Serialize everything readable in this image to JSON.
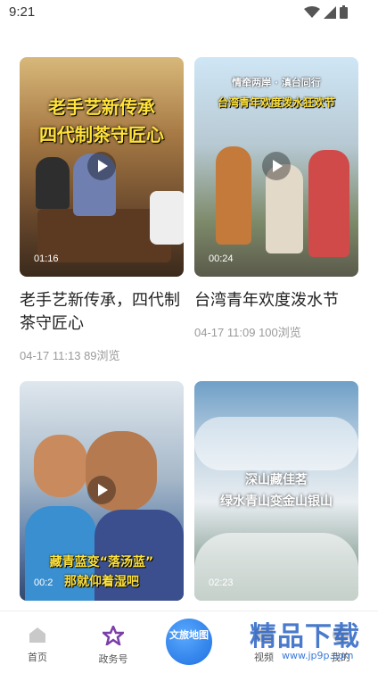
{
  "status_bar": {
    "time": "9:21"
  },
  "videos": [
    {
      "title": "老手艺新传承，四代制茶守匠心",
      "duration": "01:16",
      "date": "04-17 11:13",
      "views": "89浏览",
      "overlay_lines": [
        "老手艺新传承",
        "四代制茶守匠心"
      ]
    },
    {
      "title": "台湾青年欢度泼水节",
      "duration": "00:24",
      "date": "04-17 11:09",
      "views": "100浏览",
      "overlay_lines": [
        "情牵两岸 · 滇台同行",
        "台湾青年欢度泼水狂欢节"
      ]
    },
    {
      "title": "",
      "duration": "00:2",
      "date": "",
      "views": "",
      "overlay_lines": [
        "藏青蓝变“落汤蓝”",
        "那就仰着湿吧"
      ]
    },
    {
      "title": "",
      "duration": "02:23",
      "date": "",
      "views": "",
      "overlay_lines": [
        "深山藏佳茗",
        "绿水青山变金山银山"
      ]
    }
  ],
  "bottom_nav": {
    "home": "首页",
    "gov": "政务号",
    "center": "文旅地图",
    "video": "视频",
    "mine": "我的"
  },
  "watermark": {
    "text": "精品下载",
    "sub": "www.jp9p.com"
  },
  "colors": {
    "accent": "#1d6fe0",
    "muted": "#9a9a9a"
  }
}
